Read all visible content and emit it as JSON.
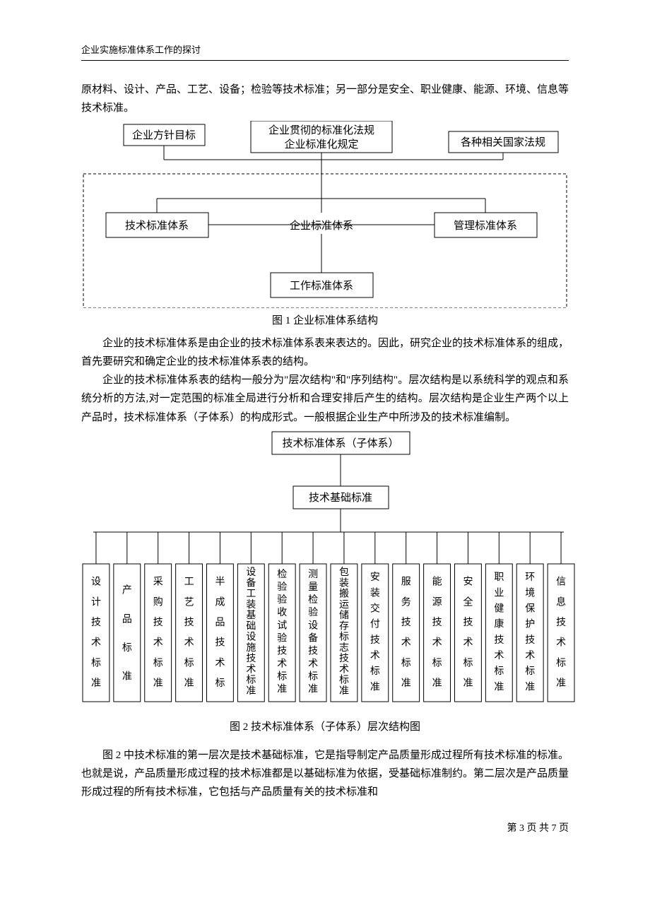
{
  "header": "企业实施标准体系工作的探讨",
  "para1": "原材料、设计、产品、工艺、设备；检验等技术标准；另一部分是安全、职业健康、能源、环境、信息等技术标准。",
  "fig1": {
    "box_top_left": "企业方针目标",
    "box_top_mid_line1": "企业贯彻的标准化法规",
    "box_top_mid_line2": "企业标准化规定",
    "box_top_right": "各种相关国家法规",
    "box_mid_left": "技术标准体系",
    "box_mid_center": "企业标准体系",
    "box_mid_right": "管理标准体系",
    "box_bottom": "工作标准体系",
    "caption": "图 1   企业标准体系结构"
  },
  "para2": "企业的技术标准体系是由企业的技术标准体系表来表达的。因此，研究企业的技术标准体系的组成，首先要研究和确定企业的技术标准体系表的结构。",
  "para3": "企业的技术标准体系表的结构一般分为\"层次结构\"和\"序列结构\"。层次结构是以系统科学的观点和系统分析的方法,对一定范围的标准全局进行分析和合理安排后产生的结构。层次结构是企业生产两个以上产品时，技术标准体系（子体系）的构成形式。一般根据企业生产中所涉及的技术标准编制。",
  "fig2": {
    "top": "技术标准体系（子体系）",
    "mid": "技术基础标准",
    "leaves": [
      "设计技术标准",
      "产品标准",
      "采购技术标准",
      "工艺技术标准",
      "半成品技术标",
      "设备工装基础设施技术标准",
      "检验验收试验技术标准",
      "测量检验设备技术标准",
      "包装搬运储存标志技术标准",
      "安装交付技术标准",
      "服务技术标准",
      "能源技术标准",
      "安全技术标准",
      "职业健康技术标准",
      "环境保护技术标准",
      "信息技术标准"
    ],
    "caption": "图 2   技术标准体系（子体系）层次结构图"
  },
  "para4": "图 2 中技术标准的第一层次是技术基础标准，它是指导制定产品质量形成过程所有技术标准的标准。也就是说，产品质量形成过程的技术标准都是以基础标准为依据，受基础标准制约。第二层次是产品质量形成过程的所有技术标准，它包括与产品质量有关的技术标准和",
  "footer": "第 3 页 共 7 页"
}
